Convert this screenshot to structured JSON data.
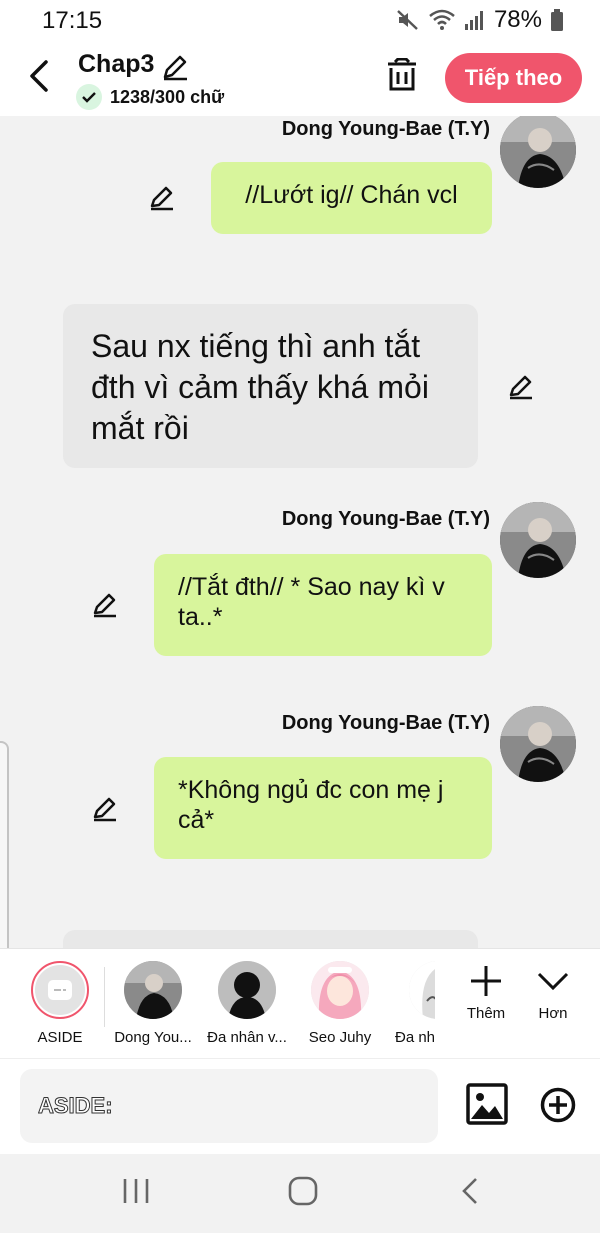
{
  "status_bar": {
    "time": "17:15",
    "battery": "78%"
  },
  "header": {
    "title": "Chap3",
    "word_count": "1238/300 chữ",
    "next_label": "Tiếp theo"
  },
  "messages": [
    {
      "type": "dialogue",
      "sender": "Dong Young-Bae (T.Y)",
      "text": "//Lướt ig// Chán vcl"
    },
    {
      "type": "narration",
      "text": "Sau nx tiếng thì anh tắt đth vì cảm thấy khá mỏi mắt rồi"
    },
    {
      "type": "dialogue",
      "sender": "Dong Young-Bae (T.Y)",
      "text": "//Tắt đth// * Sao nay kì v ta..*"
    },
    {
      "type": "dialogue",
      "sender": "Dong Young-Bae (T.Y)",
      "text": "*Không ngủ đc con mẹ j cả*"
    }
  ],
  "characters": [
    {
      "label": "ASIDE",
      "icon": "aside-icon",
      "selected": true
    },
    {
      "label": "Dong You...",
      "icon": "avatar-dong-young-bae"
    },
    {
      "label": "Đa nhân v...",
      "icon": "avatar-silhouette"
    },
    {
      "label": "Seo Juhy",
      "icon": "avatar-seo-juhy"
    },
    {
      "label": "Đa nhâ",
      "icon": "avatar-partial"
    }
  ],
  "actions": {
    "add_label": "Thêm",
    "more_label": "Hơn"
  },
  "input": {
    "placeholder": "ASIDE:",
    "value": ""
  },
  "colors": {
    "accent": "#f0556c",
    "bubble": "#d8f59c",
    "narration": "#e8e8e8",
    "chat_bg": "#f2f2f2"
  }
}
